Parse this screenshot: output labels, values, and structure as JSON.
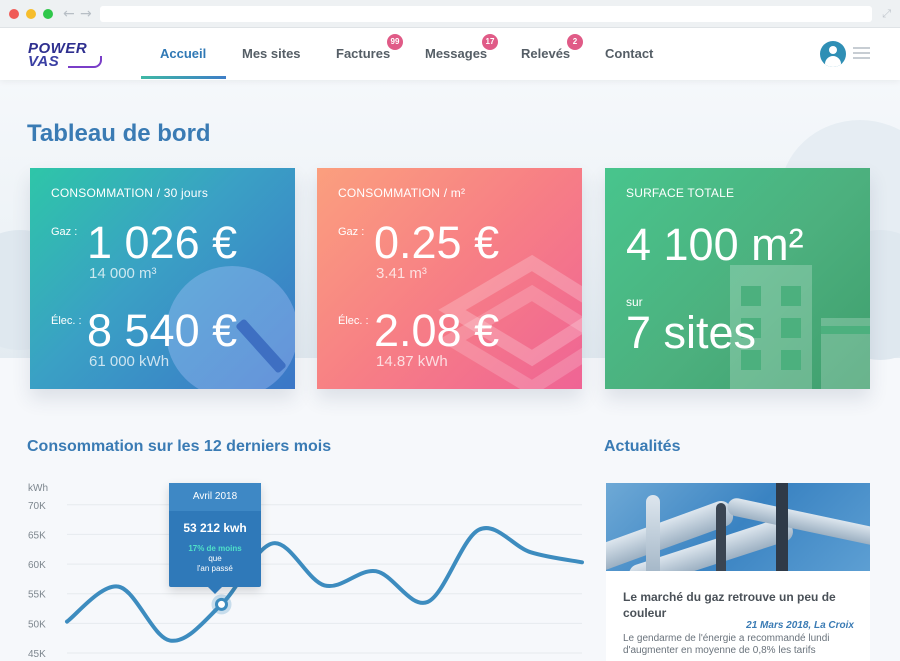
{
  "nav": {
    "items": [
      {
        "label": "Accueil",
        "badge": null
      },
      {
        "label": "Mes sites",
        "badge": null
      },
      {
        "label": "Factures",
        "badge": "99"
      },
      {
        "label": "Messages",
        "badge": "17"
      },
      {
        "label": "Relevés",
        "badge": "2"
      },
      {
        "label": "Contact",
        "badge": null
      }
    ],
    "active": "Accueil"
  },
  "logo": {
    "line1": "POWER",
    "line2": "VAS"
  },
  "page": {
    "title": "Tableau de bord"
  },
  "cards": {
    "consumption": {
      "label": "CONSOMMATION / 30 jours",
      "gas_prefix": "Gaz :",
      "gas_value": "1 026 €",
      "gas_sub": "14 000 m³",
      "elec_prefix": "Élec. :",
      "elec_value": "8 540 €",
      "elec_sub": "61 000 kWh"
    },
    "consumption_per_m2": {
      "label": "CONSOMMATION / m²",
      "gas_prefix": "Gaz :",
      "gas_value": "0.25 €",
      "gas_sub": "3.41 m³",
      "elec_prefix": "Élec. :",
      "elec_value": "2.08 €",
      "elec_sub": "14.87 kWh"
    },
    "surface": {
      "label": "SURFACE TOTALE",
      "value": "4 100 m²",
      "sites_prefix": "sur",
      "sites_value": "7 sites"
    }
  },
  "chart_section": {
    "title": "Consommation sur les 12 derniers mois"
  },
  "news_section": {
    "title": "Actualités"
  },
  "news": {
    "title": "Le marché du gaz retrouve un peu de couleur",
    "date": "21 Mars 2018, La Croix",
    "text": "Le gendarme de l'énergie a recommandé lundi d'augmenter en moyenne de 0,8% les tarifs"
  },
  "tooltip": {
    "month": "Avril 2018",
    "value": "53 212 kwh",
    "pct": "17% de moins",
    "line2": "que",
    "line3": "l'an passé"
  },
  "chart_data": {
    "type": "line",
    "ylabel": "kWh",
    "yticks": [
      "70K",
      "65K",
      "60K",
      "55K",
      "50K",
      "45K"
    ],
    "ylim": [
      45000,
      73000
    ],
    "x": [
      0,
      1,
      2,
      3,
      4,
      5,
      6,
      7,
      8,
      9,
      10
    ],
    "series": [
      {
        "values": [
          50300,
          56200,
          47100,
          53200,
          63500,
          56400,
          58800,
          53600,
          65800,
          62000,
          60300
        ]
      }
    ],
    "highlight_index": 3,
    "grid": true,
    "line_color": "#3d8cbf"
  },
  "colors": {
    "accent": "#3a7bb4",
    "badge": "#e05b87"
  }
}
